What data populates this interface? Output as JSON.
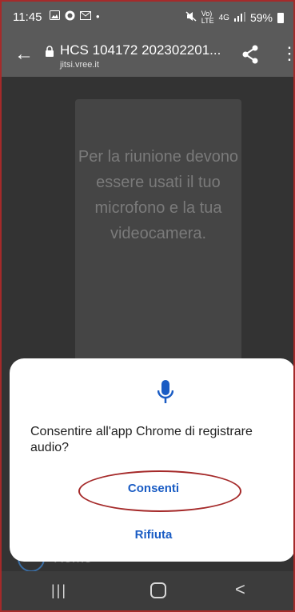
{
  "status_bar": {
    "time": "11:45",
    "left_icons": [
      "gallery-icon",
      "chat-icon",
      "mail-icon",
      "dot"
    ],
    "dot": "•",
    "network": "4G",
    "battery": "59%"
  },
  "toolbar": {
    "back_glyph": "←",
    "title": "HCS 104172 202302201...",
    "url": "jitsi.vree.it",
    "menu_glyph": "⋮"
  },
  "page": {
    "notice": "Per la riunione devono essere usati il tuo microfono e la tua videocamera.",
    "home_label": "Home"
  },
  "dialog": {
    "message": "Consentire all'app Chrome di registrare audio?",
    "allow_label": "Consenti",
    "deny_label": "Rifiuta",
    "accent": "#1a5cc4"
  },
  "nav_bar": {
    "recents_glyph": "|||",
    "back_glyph": "<"
  }
}
